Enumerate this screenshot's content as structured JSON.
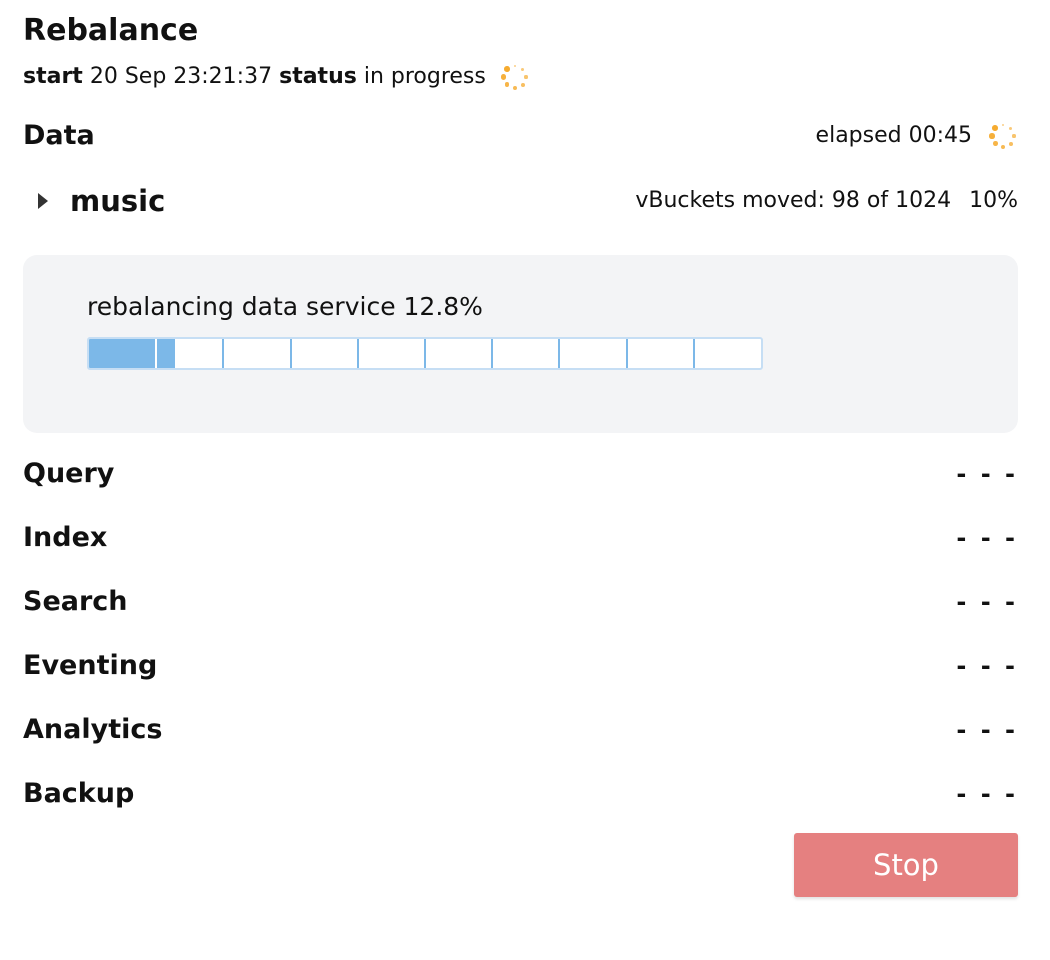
{
  "title": "Rebalance",
  "status_line": {
    "start_key": "start",
    "start_value": "20 Sep 23:21:37",
    "status_key": "status",
    "status_value": "in progress",
    "icon": "loading-spinner-icon"
  },
  "data_section": {
    "label": "Data",
    "elapsed": "elapsed 00:45",
    "icon": "loading-spinner-icon",
    "bucket": {
      "name": "music",
      "moved_text": "vBuckets moved: 98 of 1024",
      "percent": "10%"
    },
    "service": {
      "label": "rebalancing data service 12.8%",
      "progress": 0.128
    }
  },
  "services": [
    {
      "label": "Query",
      "value": "- - -"
    },
    {
      "label": "Index",
      "value": "- - -"
    },
    {
      "label": "Search",
      "value": "- - -"
    },
    {
      "label": "Eventing",
      "value": "- - -"
    },
    {
      "label": "Analytics",
      "value": "- - -"
    },
    {
      "label": "Backup",
      "value": "- - -"
    }
  ],
  "stop_label": "Stop",
  "colors": {
    "spinner": "#f5a623",
    "progress_fill": "#7cb8e8",
    "progress_border": "#c6def4",
    "panel_bg": "#f3f4f6",
    "stop_button": "#e58080"
  }
}
